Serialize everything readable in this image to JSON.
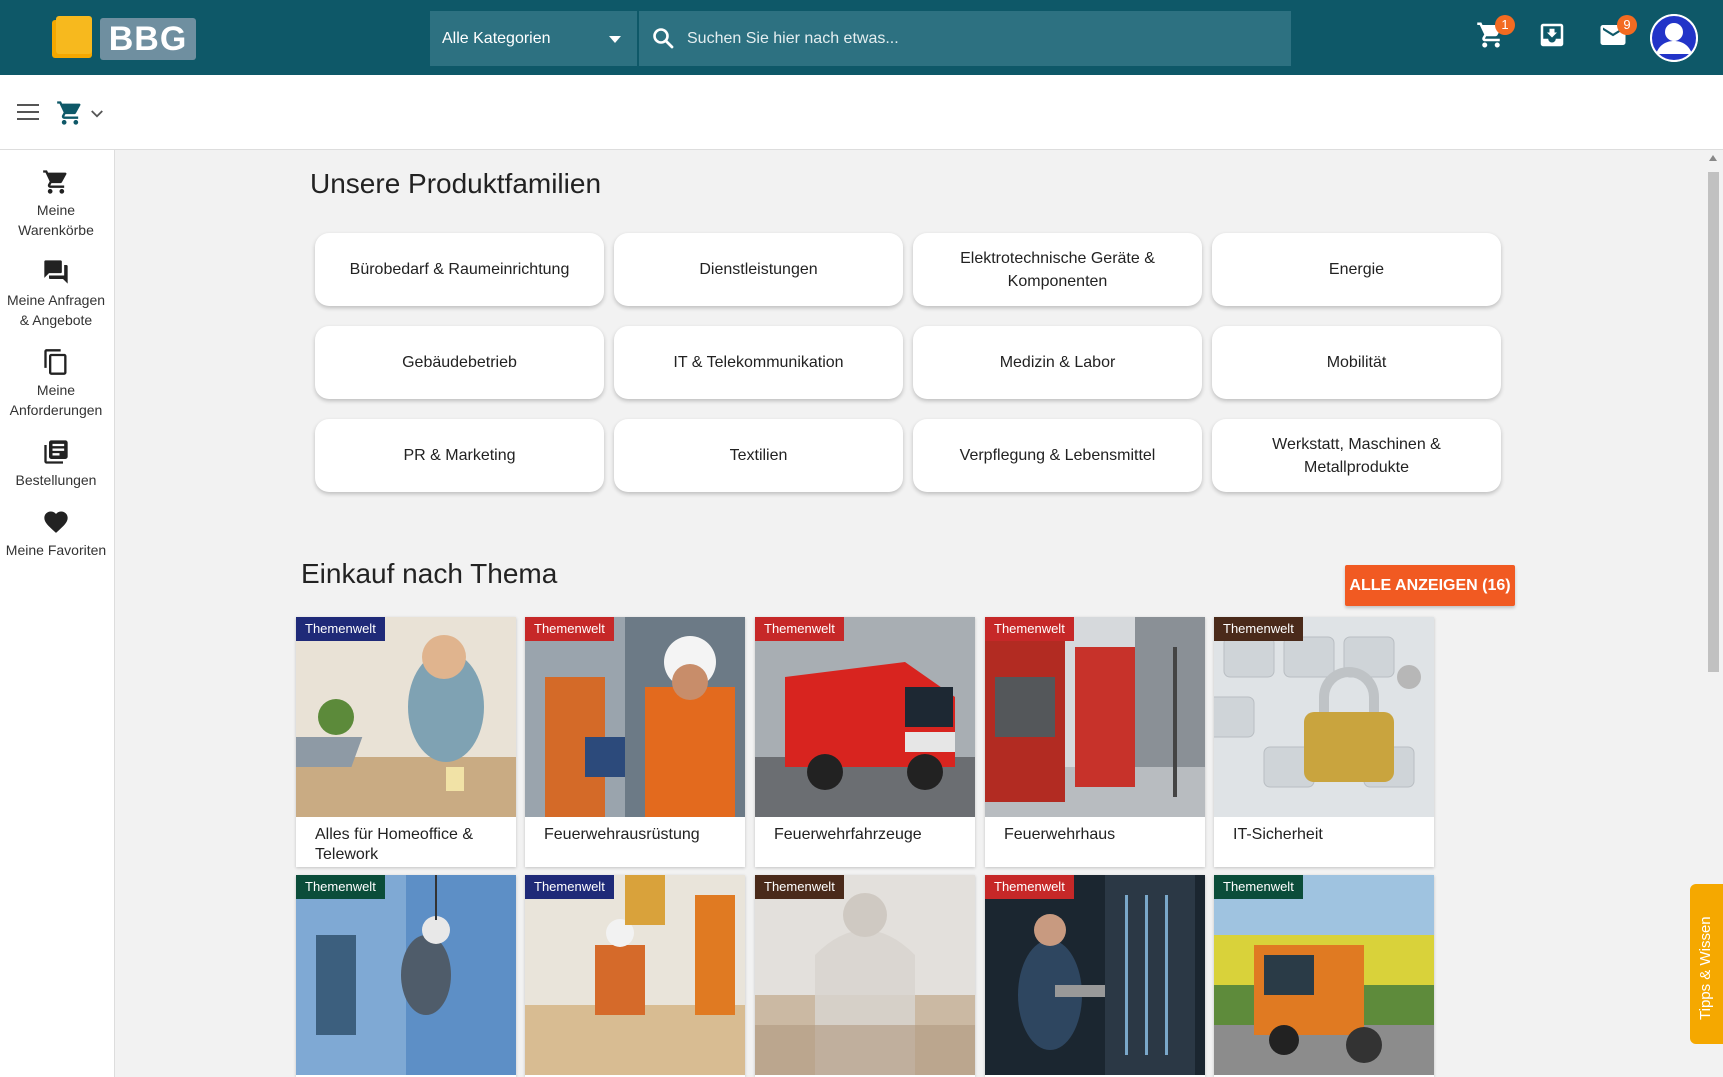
{
  "header": {
    "logo_text": "BBG",
    "category_select": "Alle Kategorien",
    "search_placeholder": "Suchen Sie hier nach etwas...",
    "cart_badge": "1",
    "mail_badge": "9"
  },
  "sidebar": {
    "items": [
      {
        "label_line1": "Meine",
        "label_line2": "Warenkörbe"
      },
      {
        "label_line1": "Meine Anfragen",
        "label_line2": "& Angebote"
      },
      {
        "label_line1": "Meine",
        "label_line2": "Anforderungen"
      },
      {
        "label_line1": "Bestellungen",
        "label_line2": ""
      },
      {
        "label_line1": "Meine Favoriten",
        "label_line2": ""
      }
    ]
  },
  "families": {
    "title": "Unsere Produktfamilien",
    "items": [
      "Bürobedarf & Raumeinrichtung",
      "Dienstleistungen",
      "Elektrotechnische Geräte & Komponenten",
      "Energie",
      "Gebäudebetrieb",
      "IT & Telekommunikation",
      "Medizin & Labor",
      "Mobilität",
      "PR & Marketing",
      "Textilien",
      "Verpflegung & Lebensmittel",
      "Werkstatt, Maschinen & Metallprodukte"
    ]
  },
  "themes": {
    "title": "Einkauf nach Thema",
    "show_all": "ALLE ANZEIGEN (16)",
    "tag": "Themenwelt",
    "cards": [
      {
        "label": "Alles für Homeoffice & Telework",
        "tag_color": "#1f2a78"
      },
      {
        "label": "Feuerwehrausrüstung",
        "tag_color": "#c62828"
      },
      {
        "label": "Feuerwehrfahrzeuge",
        "tag_color": "#c62828"
      },
      {
        "label": "Feuerwehrhaus",
        "tag_color": "#c62828"
      },
      {
        "label": "IT-Sicherheit",
        "tag_color": "#4a2a1a"
      },
      {
        "label": "",
        "tag_color": "#0b4d3a"
      },
      {
        "label": "",
        "tag_color": "#1f2a78"
      },
      {
        "label": "",
        "tag_color": "#4a2a1a"
      },
      {
        "label": "",
        "tag_color": "#c62828"
      },
      {
        "label": "",
        "tag_color": "#0b4d3a"
      }
    ]
  },
  "tips_tab": "Tipps & Wissen"
}
